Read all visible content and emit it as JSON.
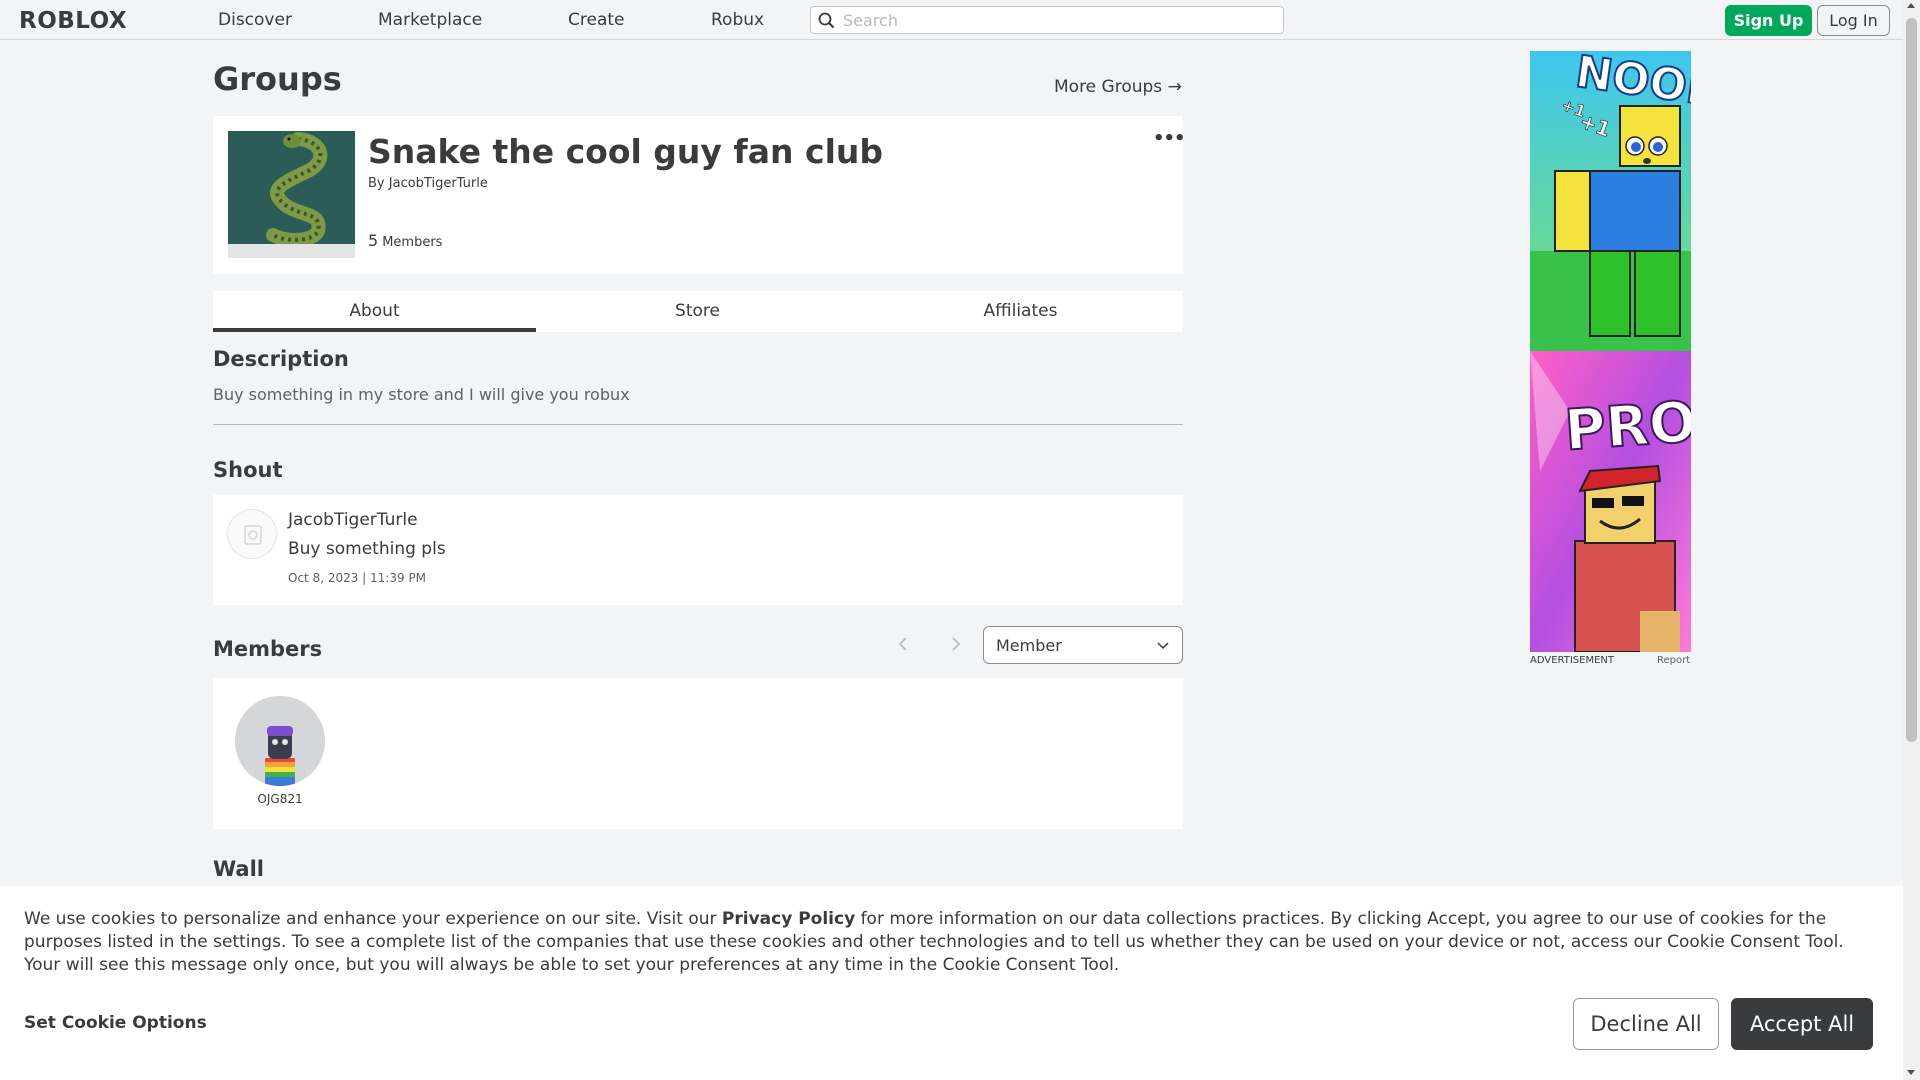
{
  "header": {
    "logo": "ROBLOX",
    "nav": [
      "Discover",
      "Marketplace",
      "Create",
      "Robux"
    ],
    "search_placeholder": "Search",
    "signup": "Sign Up",
    "login": "Log In"
  },
  "page": {
    "title": "Groups",
    "more_groups": "More Groups →"
  },
  "group": {
    "name": "Snake the cool guy fan club",
    "by_label": "By",
    "owner": "JacobTigerTurle",
    "member_count": "5",
    "members_label": "Members",
    "menu_icon": "more-dots-icon"
  },
  "tabs": [
    "About",
    "Store",
    "Affiliates"
  ],
  "description": {
    "heading": "Description",
    "text": "Buy something in my store and I will give you robux"
  },
  "shout": {
    "heading": "Shout",
    "user": "JacobTigerTurle",
    "body": "Buy something pls",
    "timestamp": "Oct 8, 2023 | 11:39 PM"
  },
  "members": {
    "heading": "Members",
    "role_selected": "Member",
    "list": [
      {
        "name": "OJG821"
      }
    ]
  },
  "wall": {
    "heading": "Wall"
  },
  "ad": {
    "label": "ADVERTISEMENT",
    "report": "Report",
    "text_top": "NOOB",
    "text_bottom": "PRO",
    "badge_1": "+1",
    "badge_2": "+1"
  },
  "cookie_banner": {
    "text_before": "We use cookies to personalize and enhance your experience on our site. Visit our ",
    "link": "Privacy Policy",
    "text_after": " for more information on our data collections practices. By clicking Accept, you agree to our use of cookies for the purposes listed in the settings. To see a complete list of the companies that use these cookies and other technologies and to tell us whether they can be used on your device or not, access our Cookie Consent Tool. Your will see this message only once, but you will always be able to set your preferences at any time in the Cookie Consent Tool.",
    "options": "Set Cookie Options",
    "decline": "Decline All",
    "accept": "Accept All"
  },
  "colors": {
    "signup_green": "#00a859",
    "text_dark": "#393b3d",
    "page_bg": "#f2f4f5"
  }
}
